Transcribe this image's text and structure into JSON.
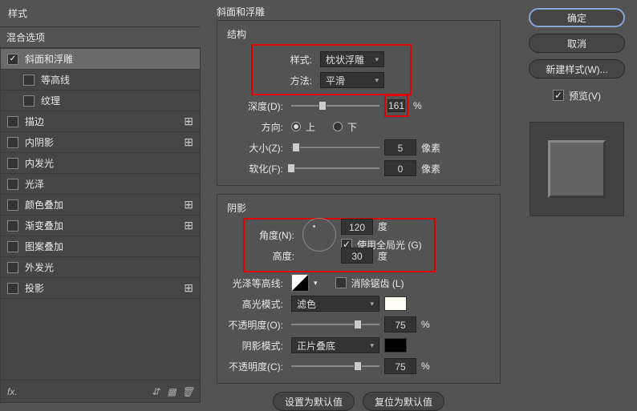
{
  "sidebar": {
    "head1": "样式",
    "head2": "混合选项",
    "items": [
      {
        "label": "斜面和浮雕",
        "check": true,
        "selected": true
      },
      {
        "label": "等高线",
        "sub": true
      },
      {
        "label": "纹理",
        "sub": true
      },
      {
        "label": "描边",
        "plus": true
      },
      {
        "label": "内阴影",
        "plus": true
      },
      {
        "label": "内发光"
      },
      {
        "label": "光泽"
      },
      {
        "label": "颜色叠加",
        "plus": true
      },
      {
        "label": "渐变叠加",
        "plus": true
      },
      {
        "label": "图案叠加"
      },
      {
        "label": "外发光"
      },
      {
        "label": "投影",
        "plus": true
      }
    ],
    "fx": "fx."
  },
  "main": {
    "title": "斜面和浮雕",
    "structure": {
      "title": "结构",
      "style_l": "样式:",
      "style_v": "枕状浮雕",
      "method_l": "方法:",
      "method_v": "平滑",
      "depth_l": "深度(D):",
      "depth_v": "161",
      "depth_u": "%",
      "dir_l": "方向:",
      "up": "上",
      "down": "下",
      "size_l": "大小(Z):",
      "size_v": "5",
      "px": "像素",
      "soft_l": "软化(F):",
      "soft_v": "0"
    },
    "shading": {
      "title": "阴影",
      "angle_l": "角度(N):",
      "angle_v": "120",
      "deg": "度",
      "global": "使用全局光 (G)",
      "alt_l": "高度:",
      "alt_v": "30",
      "gloss_l": "光泽等高线:",
      "anti": "消除锯齿 (L)",
      "hi_l": "高光模式:",
      "hi_v": "滤色",
      "op1_l": "不透明度(O):",
      "op1_v": "75",
      "pct": "%",
      "sh_l": "阴影模式:",
      "sh_v": "正片叠底",
      "op2_l": "不透明度(C):",
      "op2_v": "75"
    },
    "defbtn": "设置为默认值",
    "resetbtn": "复位为默认值"
  },
  "side2": {
    "ok": "确定",
    "cancel": "取消",
    "newstyle": "新建样式(W)...",
    "preview": "预览(V)"
  }
}
